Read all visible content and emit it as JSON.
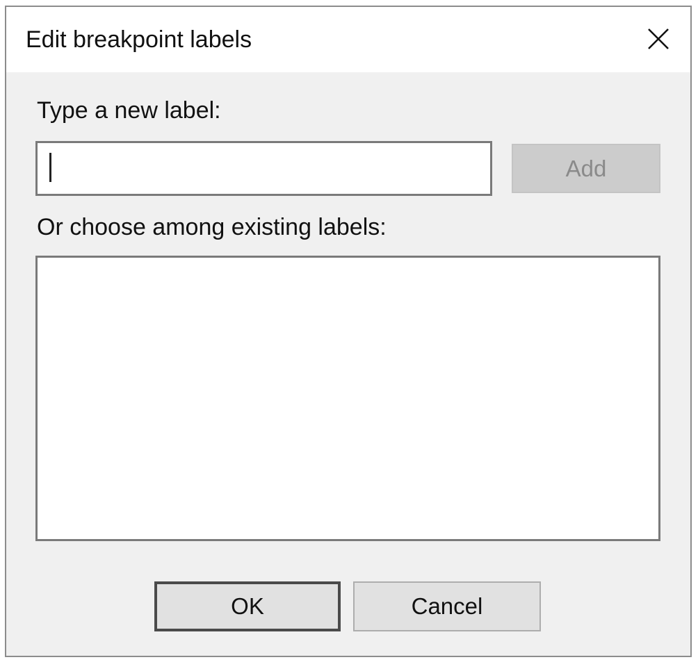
{
  "dialog": {
    "title": "Edit breakpoint labels",
    "close_icon": "close-icon"
  },
  "new_label": {
    "prompt": "Type a new label:",
    "value": "",
    "add_label": "Add",
    "add_enabled": false
  },
  "existing_labels": {
    "prompt": "Or choose among existing labels:",
    "items": []
  },
  "buttons": {
    "ok_label": "OK",
    "cancel_label": "Cancel"
  },
  "colors": {
    "dialog_background": "#f0f0f0",
    "titlebar_background": "#ffffff",
    "disabled_button": "#cccccc",
    "disabled_text": "#8a8a8a",
    "default_button_border": "#4a4a4a"
  }
}
